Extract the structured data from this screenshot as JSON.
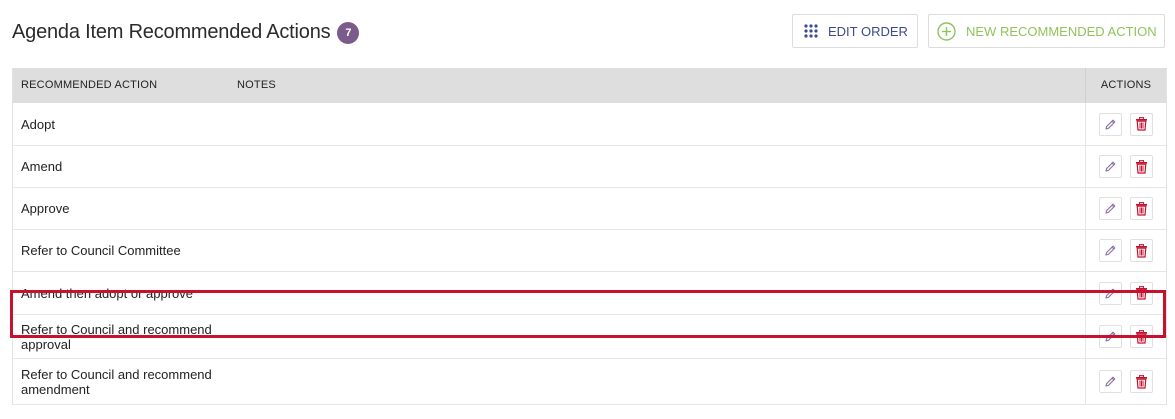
{
  "header": {
    "title": "Agenda Item Recommended Actions",
    "count": "7",
    "edit_order_label": "EDIT ORDER",
    "new_action_label": "NEW RECOMMENDED ACTION"
  },
  "table": {
    "columns": {
      "action": "RECOMMENDED ACTION",
      "notes": "NOTES",
      "actions": "ACTIONS"
    },
    "rows": [
      {
        "action": "Adopt",
        "notes": ""
      },
      {
        "action": "Amend",
        "notes": ""
      },
      {
        "action": "Approve",
        "notes": ""
      },
      {
        "action": "Refer to Council Committee",
        "notes": ""
      },
      {
        "action": "Amend then adopt or approve",
        "notes": ""
      },
      {
        "action": "Refer to Council and recommend approval",
        "notes": ""
      },
      {
        "action": "Refer to Council and recommend amendment",
        "notes": ""
      }
    ],
    "highlighted_row": 6
  },
  "icons": {
    "edit_order": "grid-dots-icon",
    "new_action": "plus-circle-icon",
    "edit": "pencil-icon",
    "delete": "trash-icon"
  },
  "colors": {
    "badge": "#7a5b8c",
    "edit_order_text": "#3c4a8f",
    "new_action_text": "#8fc45a",
    "delete_icon": "#c4122f",
    "edit_icon": "#8a6fa0",
    "highlight": "#c4122f",
    "header_bg": "#dedede"
  }
}
